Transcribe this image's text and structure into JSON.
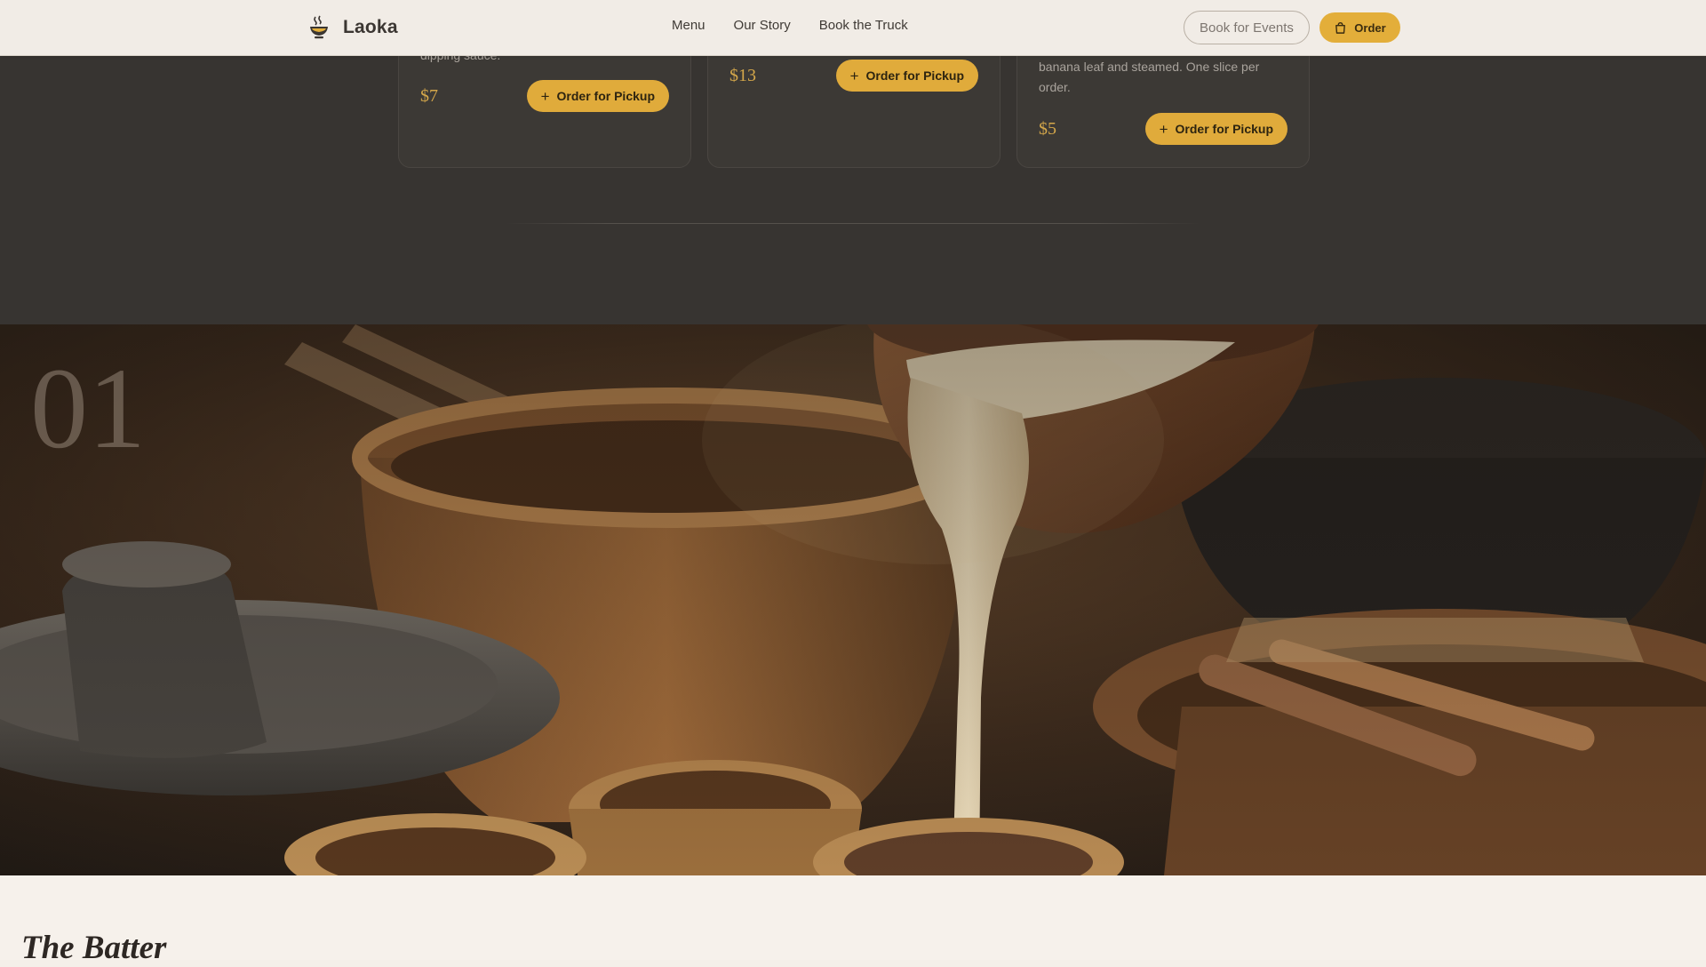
{
  "nav": {
    "brand": "Laoka",
    "links": [
      "Menu",
      "Our Story",
      "Book the Truck"
    ],
    "events_label": "Book for Events",
    "order_label": "Order"
  },
  "menu_cards": [
    {
      "description": "dipping sauce.",
      "price": "$7",
      "button": "Order for Pickup"
    },
    {
      "description": "",
      "price": "$13",
      "button": "Order for Pickup"
    },
    {
      "description": "banana leaf and steamed. One slice per order.",
      "price": "$5",
      "button": "Order for Pickup"
    }
  ],
  "hero": {
    "number": "01"
  },
  "section": {
    "title": "The Batter"
  },
  "colors": {
    "accent": "#e3ae3a",
    "dark_band": "#373431",
    "cream": "#f6f1eb"
  }
}
